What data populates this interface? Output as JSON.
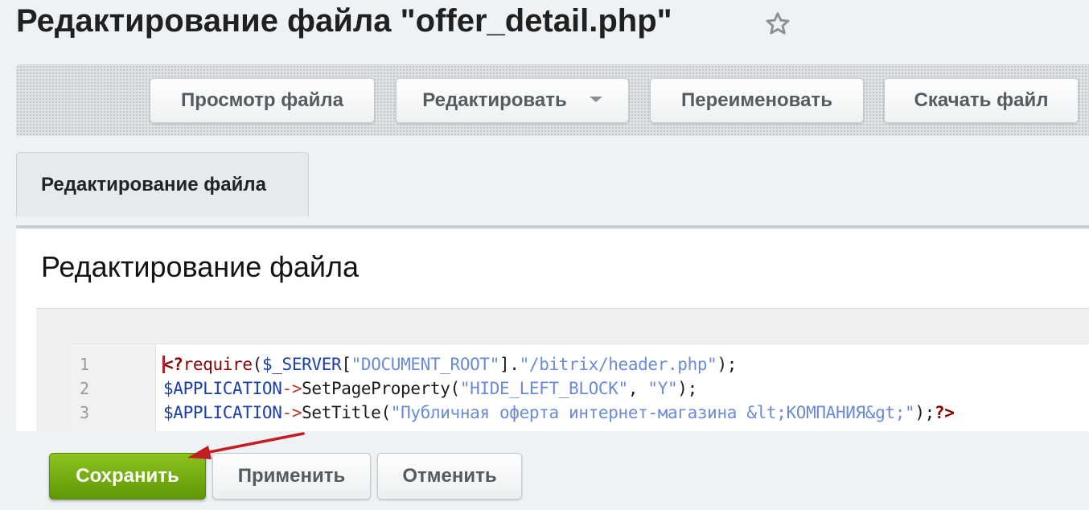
{
  "page": {
    "title": "Редактирование файла \"offer_detail.php\""
  },
  "toolbar": {
    "buttons": [
      {
        "label": "Просмотр файла"
      },
      {
        "label": "Редактировать"
      },
      {
        "label": "Переименовать"
      },
      {
        "label": "Скачать файл"
      }
    ]
  },
  "tabs": [
    {
      "label": "Редактирование файла",
      "active": true
    }
  ],
  "section": {
    "heading": "Редактирование файла"
  },
  "editor": {
    "line_numbers": [
      "1",
      "2",
      "3"
    ],
    "lines": [
      {
        "tokens": [
          {
            "text": "<?",
            "type": "tag"
          },
          {
            "text": "require",
            "type": "fn"
          },
          {
            "text": "(",
            "type": "pl"
          },
          {
            "text": "$_SERVER",
            "type": "var"
          },
          {
            "text": "[",
            "type": "pl"
          },
          {
            "text": "\"DOCUMENT_ROOT\"",
            "type": "str"
          },
          {
            "text": "].",
            "type": "pl"
          },
          {
            "text": "\"/bitrix/header.php\"",
            "type": "str"
          },
          {
            "text": ");",
            "type": "pl"
          }
        ]
      },
      {
        "tokens": [
          {
            "text": "$APPLICATION",
            "type": "var"
          },
          {
            "text": "->",
            "type": "op"
          },
          {
            "text": "SetPageProperty",
            "type": "pl"
          },
          {
            "text": "(",
            "type": "pl"
          },
          {
            "text": "\"HIDE_LEFT_BLOCK\"",
            "type": "str"
          },
          {
            "text": ", ",
            "type": "pl"
          },
          {
            "text": "\"Y\"",
            "type": "str"
          },
          {
            "text": ");",
            "type": "pl"
          }
        ]
      },
      {
        "tokens": [
          {
            "text": "$APPLICATION",
            "type": "var"
          },
          {
            "text": "->",
            "type": "op"
          },
          {
            "text": "SetTitle",
            "type": "pl"
          },
          {
            "text": "(",
            "type": "pl"
          },
          {
            "text": "\"Публичная оферта интернет-магазина &lt;КОМПАНИЯ&gt;\"",
            "type": "str"
          },
          {
            "text": ");",
            "type": "pl"
          },
          {
            "text": "?>",
            "type": "tag"
          }
        ]
      }
    ]
  },
  "footer": {
    "save_label": "Сохранить",
    "apply_label": "Применить",
    "cancel_label": "Отменить"
  },
  "icons": {
    "favorite": "star-outline-icon",
    "dropdown": "caret-down-icon",
    "annotation": "red-arrow"
  },
  "colors": {
    "accent_green": "#6fa80f",
    "annotation_red": "#c21d22",
    "code_tag": "#8b0000",
    "code_var": "#1b3fa6",
    "code_string": "#6a8bd6",
    "code_operator": "#c03a2b"
  }
}
